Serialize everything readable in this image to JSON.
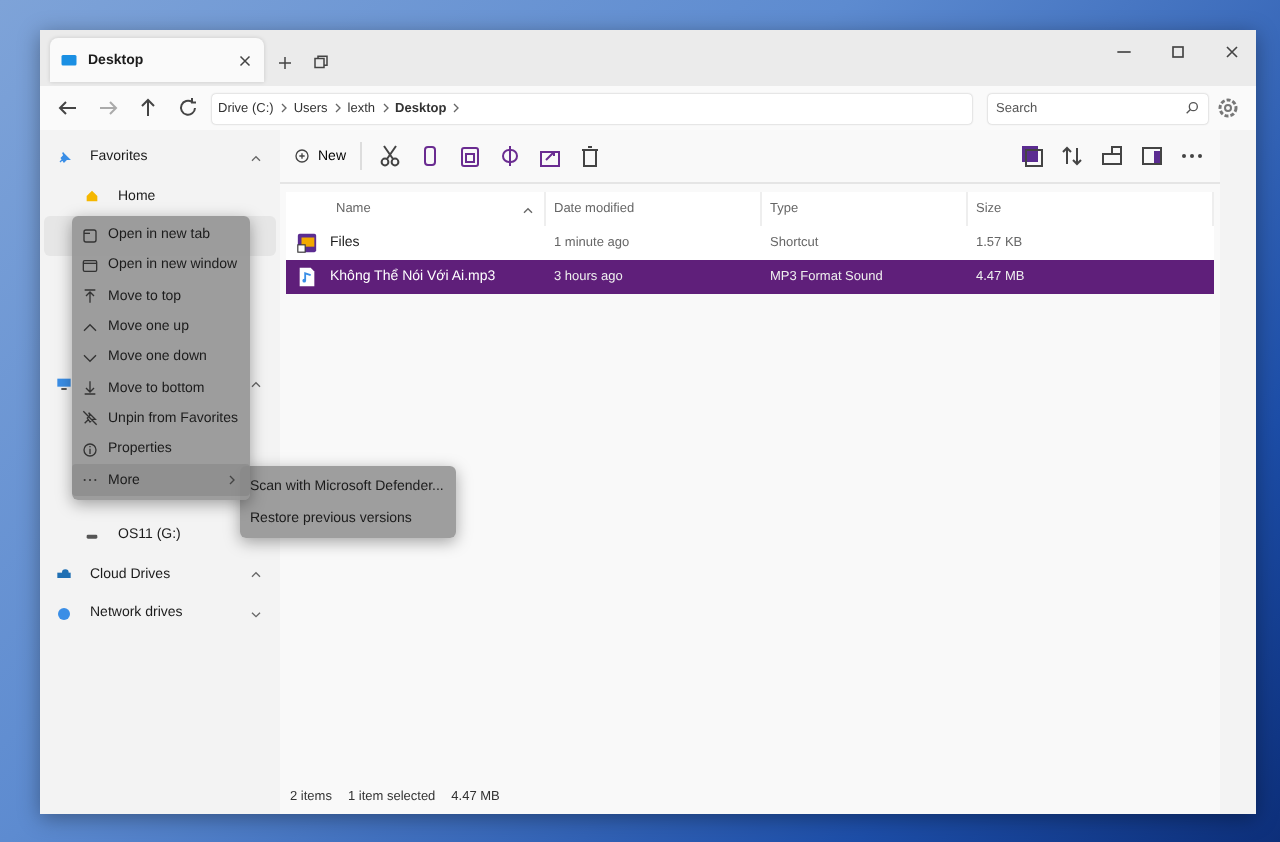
{
  "window": {
    "tab": {
      "title": "Desktop",
      "selected": true
    }
  },
  "address_bar": {
    "path": [
      "Drive (C:)",
      "Users",
      "lexth",
      "Desktop"
    ]
  },
  "search": {
    "placeholder": "Search"
  },
  "sidebar": {
    "items": [
      {
        "label": "Favorites",
        "kind": "section",
        "expanded": true,
        "children": [
          {
            "label": "Home",
            "selected": false
          },
          {
            "selected": true
          }
        ]
      },
      {
        "kind": "section",
        "expanded": true,
        "children": [
          {
            "label": "OS11 (G:)",
            "selected": false
          }
        ]
      },
      {
        "label": "Cloud Drives",
        "kind": "section",
        "expanded": true
      },
      {
        "label": "Network drives",
        "kind": "section",
        "expanded": false
      }
    ]
  },
  "toolbar": {
    "new_label": "New"
  },
  "table": {
    "columns": [
      "Name",
      "Date modified",
      "Type",
      "Size"
    ],
    "rows": [
      {
        "name": "Files",
        "date": "1 minute ago",
        "type": "Shortcut",
        "size": "1.57 KB",
        "selected": false
      },
      {
        "name": "Không Thể Nói Với Ai.mp3",
        "date": "3 hours ago",
        "type": "MP3 Format Sound",
        "size": "4.47 MB",
        "selected": true
      }
    ]
  },
  "context_menu": {
    "items": [
      {
        "label": "Open in new tab"
      },
      {
        "label": "Open in new window"
      },
      {
        "label": "Move to top"
      },
      {
        "label": "Move one up"
      },
      {
        "label": "Move one down"
      },
      {
        "label": "Move to bottom"
      },
      {
        "label": "Unpin from Favorites"
      },
      {
        "label": "Properties"
      },
      {
        "label": "More",
        "selected": true,
        "children": [
          {
            "label": "Scan with Microsoft Defender..."
          },
          {
            "label": "Restore previous versions"
          }
        ]
      }
    ]
  },
  "status_bar": {
    "item_count": "2 items",
    "selection": "1 item selected",
    "size": "4.47 MB"
  }
}
